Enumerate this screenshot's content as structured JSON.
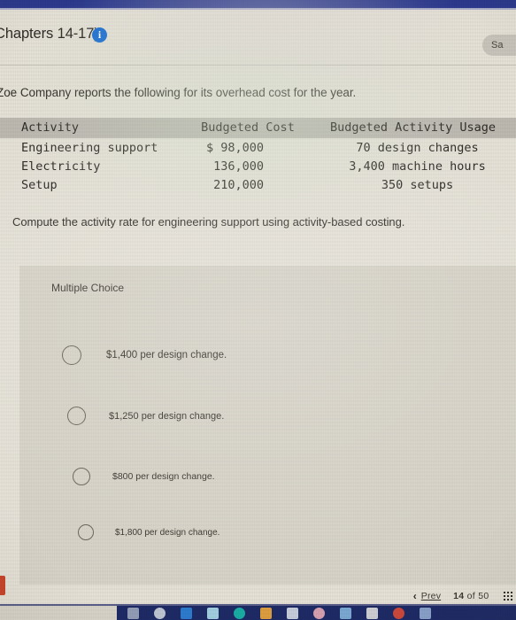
{
  "browser": {
    "accent_color": "#2c3a8e"
  },
  "header": {
    "assignment_title": "Chapters 14-17)",
    "info_icon": "i",
    "saved_button": "Sa"
  },
  "question": {
    "intro": "Zoe Company reports the following for its overhead cost for the year.",
    "prompt": "Compute the activity rate for engineering support using activity-based costing."
  },
  "table": {
    "headers": [
      "Activity",
      "Budgeted Cost",
      "Budgeted Activity Usage"
    ],
    "rows": [
      {
        "activity": "Engineering support",
        "cost": "$ 98,000",
        "usage": "70 design changes"
      },
      {
        "activity": "Electricity",
        "cost": "136,000",
        "usage": "3,400 machine hours"
      },
      {
        "activity": "Setup",
        "cost": "210,000",
        "usage": "350 setups"
      }
    ]
  },
  "answer": {
    "type_label": "Multiple Choice",
    "options": [
      {
        "label": "$1,400 per design change.",
        "selected": false
      },
      {
        "label": "$1,250 per design change.",
        "selected": false
      },
      {
        "label": "$800 per design change.",
        "selected": false
      },
      {
        "label": "$1,800 per design change.",
        "selected": false
      }
    ]
  },
  "footer": {
    "prev_label": "Prev",
    "prev_chevron": "‹",
    "current_page": "14",
    "of_label": "of",
    "total_pages": "50"
  },
  "taskbar": {
    "icon_colors": [
      "#9aa3bb",
      "#c7ccd8",
      "#2e7fd4",
      "#a9d8e8",
      "#19b5a8",
      "#e8a43c",
      "#cfd6e2",
      "#e1a6b4",
      "#7fb0d8",
      "#d8d8d8",
      "#d64a3a",
      "#8fa6cf"
    ]
  }
}
